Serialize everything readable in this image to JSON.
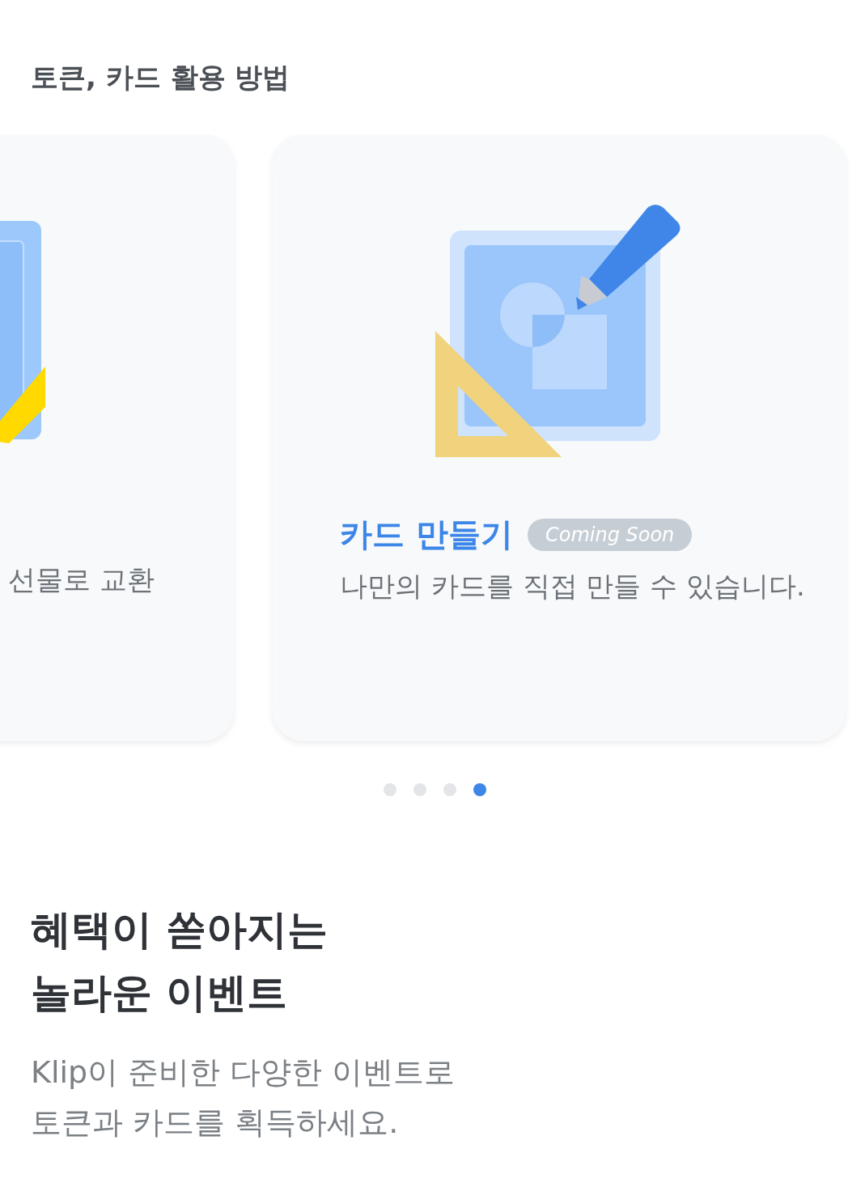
{
  "section_title": "토큰, 카드 활용 방법",
  "cards": [
    {
      "kind": "partial",
      "description": "선물로 교환"
    },
    {
      "kind": "full",
      "title": "카드 만들기",
      "badge": "Coming Soon",
      "description": "나만의 카드를 직접 만들 수 있습니다."
    }
  ],
  "indicator": [
    {
      "selected": false
    },
    {
      "selected": false
    },
    {
      "selected": false
    },
    {
      "selected": true
    }
  ],
  "event": {
    "heading": [
      "혜택이 쏟아지는",
      "놀라운 이벤트"
    ],
    "description": [
      "Klip이 준비한 다양한 이벤트로",
      "토큰과 카드를 획득하세요."
    ]
  }
}
